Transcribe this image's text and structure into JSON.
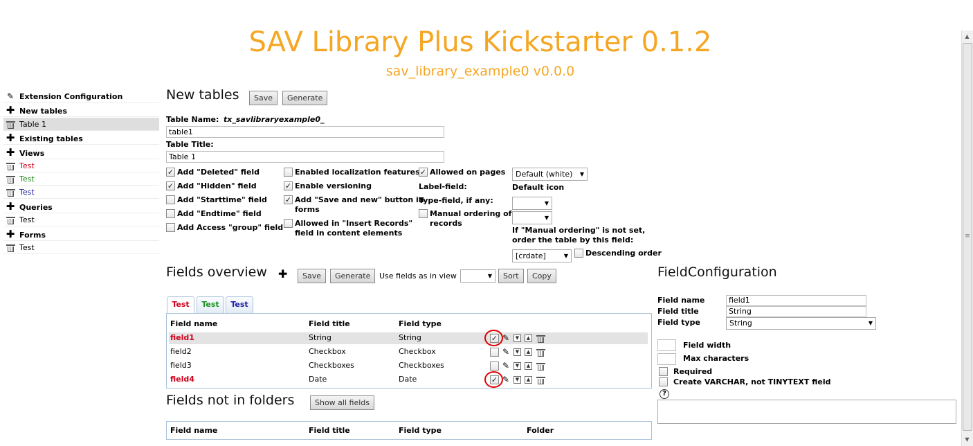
{
  "header": {
    "title": "SAV Library Plus Kickstarter 0.1.2",
    "subtitle": "sav_library_example0 v0.0.0"
  },
  "sidebar": {
    "items": [
      {
        "label": "Extension Configuration",
        "icon": "feather-icon",
        "bold": true
      },
      {
        "label": "New tables",
        "icon": "plus-icon",
        "bold": true
      },
      {
        "label": "Table 1",
        "icon": "trash-icon",
        "selected": true
      },
      {
        "label": "Existing tables",
        "icon": "plus-icon",
        "bold": true
      },
      {
        "label": "Views",
        "icon": "plus-icon",
        "bold": true
      },
      {
        "label": "Test",
        "icon": "trash-icon",
        "color": "#d0021b"
      },
      {
        "label": "Test",
        "icon": "trash-icon",
        "color": "#1a8f1a"
      },
      {
        "label": "Test",
        "icon": "trash-icon",
        "color": "#1a1aa0"
      },
      {
        "label": "Queries",
        "icon": "plus-icon",
        "bold": true
      },
      {
        "label": "Test",
        "icon": "trash-icon"
      },
      {
        "label": "Forms",
        "icon": "plus-icon",
        "bold": true
      },
      {
        "label": "Test",
        "icon": "trash-icon"
      }
    ]
  },
  "new_tables": {
    "title": "New tables",
    "save_label": "Save",
    "generate_label": "Generate",
    "table_name_label": "Table Name:",
    "table_name_prefix": "tx_savlibraryexample0_",
    "table_name_value": "table1",
    "table_title_label": "Table Title:",
    "table_title_value": "Table 1",
    "col1": [
      {
        "label": "Add \"Deleted\" field",
        "checked": true
      },
      {
        "label": "Add \"Hidden\" field",
        "checked": true
      },
      {
        "label": "Add \"Starttime\" field",
        "checked": false
      },
      {
        "label": "Add \"Endtime\" field",
        "checked": false
      },
      {
        "label": "Add Access \"group\" field",
        "checked": false
      }
    ],
    "col2": [
      {
        "label": "Enabled localization features",
        "checked": false
      },
      {
        "label": "Enable versioning",
        "checked": true
      },
      {
        "label": "Add \"Save and new\" button in",
        "label2": "forms",
        "checked": true
      },
      {
        "label": "Allowed in \"Insert Records\"",
        "label2": "field in content elements",
        "checked": false
      }
    ],
    "allowed_on_pages_label": "Allowed on pages",
    "allowed_on_pages_checked": true,
    "label_field_label": "Label-field:",
    "type_field_label": "Type-field, if any:",
    "manual_ordering_label": "Manual ordering of",
    "manual_ordering_label2": "records",
    "manual_ordering_checked": false,
    "default_select_value": "Default (white)",
    "default_icon_label": "Default icon",
    "order_note_line1": "If \"Manual ordering\" is not set,",
    "order_note_line2": "order the table by this field:",
    "order_select_value": "[crdate]",
    "descending_label": "Descending order",
    "descending_checked": false
  },
  "fields_overview": {
    "title": "Fields overview",
    "save_label": "Save",
    "generate_label": "Generate",
    "use_fields_label": "Use fields as in view",
    "sort_label": "Sort",
    "copy_label": "Copy",
    "tabs": [
      {
        "label": "Test",
        "color": "#d0021b"
      },
      {
        "label": "Test",
        "color": "#1a8f1a"
      },
      {
        "label": "Test",
        "color": "#1a1aa0"
      }
    ],
    "headers": [
      "Field name",
      "Field title",
      "Field type"
    ],
    "rows": [
      {
        "name": "field1",
        "title": "String",
        "type": "String",
        "checked": true,
        "highlight": true
      },
      {
        "name": "field2",
        "title": "Checkbox",
        "type": "Checkbox",
        "checked": false
      },
      {
        "name": "field3",
        "title": "Checkboxes",
        "type": "Checkboxes",
        "checked": false
      },
      {
        "name": "field4",
        "title": "Date",
        "type": "Date",
        "checked": true
      }
    ]
  },
  "fields_not_in_folders": {
    "title": "Fields not in folders",
    "show_all_label": "Show all fields",
    "headers": [
      "Field name",
      "Field title",
      "Field type",
      "Folder"
    ]
  },
  "field_configuration": {
    "title": "FieldConfiguration",
    "field_name_label": "Field name",
    "field_name_value": "field1",
    "field_title_label": "Field title",
    "field_title_value": "String",
    "field_type_label": "Field type",
    "field_type_value": "String",
    "field_width_label": "Field width",
    "max_chars_label": "Max characters",
    "required_label": "Required",
    "varchar_label": "Create VARCHAR, not TINYTEXT field",
    "help_glyph": "?"
  },
  "colors": {
    "title": "#f5a623",
    "accent_red": "#d0021b",
    "accent_green": "#1a8f1a",
    "accent_blue": "#1a1aa0"
  }
}
